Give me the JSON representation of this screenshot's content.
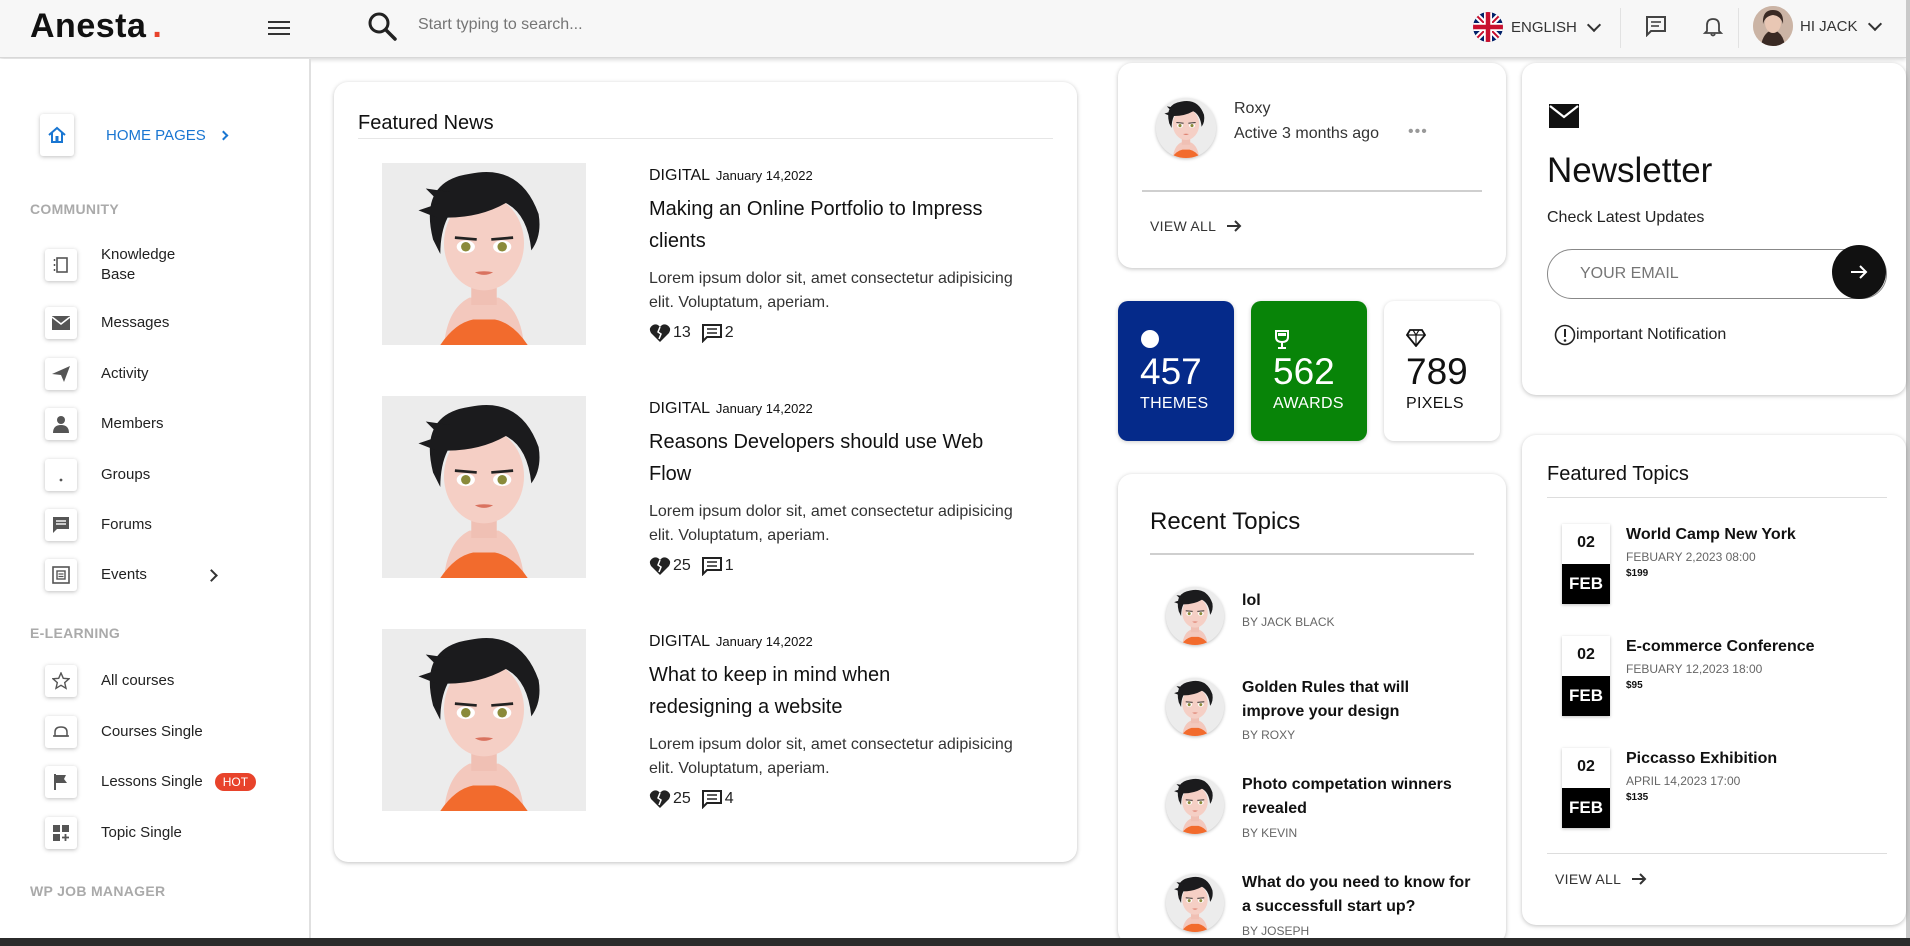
{
  "brand": {
    "name": "Anesta",
    "dot": "."
  },
  "search": {
    "placeholder": "Start typing to search..."
  },
  "header": {
    "language": "ENGLISH",
    "user_greeting": "HI JACK"
  },
  "sidebar": {
    "home_label": "HOME PAGES",
    "sections": {
      "community": "COMMUNITY",
      "elearning": "E-LEARNING",
      "wpjob": "WP JOB MANAGER"
    },
    "community_items": [
      "Knowledge Base",
      "Messages",
      "Activity",
      "Members",
      "Groups",
      "Forums",
      "Events"
    ],
    "elearning_items": [
      "All courses",
      "Courses Single",
      "Lessons Single",
      "Topic Single"
    ],
    "hot_badge": "HOT"
  },
  "featured_news": {
    "title": "Featured News",
    "items": [
      {
        "category": "DIGITAL",
        "date": "January 14,2022",
        "title": "Making an Online Portfolio to Impress clients",
        "excerpt": "Lorem ipsum dolor sit, amet consectetur adipisicing elit. Voluptatum, aperiam.",
        "likes": "13",
        "comments": "2"
      },
      {
        "category": "DIGITAL",
        "date": "January 14,2022",
        "title": "Reasons Developers should use Web Flow",
        "excerpt": "Lorem ipsum dolor sit, amet consectetur adipisicing elit. Voluptatum, aperiam.",
        "likes": "25",
        "comments": "1"
      },
      {
        "category": "DIGITAL",
        "date": "January 14,2022",
        "title": "What to keep in mind when redesigning a website",
        "excerpt": "Lorem ipsum dolor sit, amet consectetur adipisicing elit. Voluptatum, aperiam.",
        "likes": "25",
        "comments": "4"
      }
    ]
  },
  "member": {
    "name": "Roxy",
    "status": "Active 3 months ago",
    "more": "•••",
    "view_all": "VIEW ALL"
  },
  "stats": [
    {
      "value": "457",
      "label": "THEMES",
      "bg": "#052a8a",
      "icon": "circle-icon"
    },
    {
      "value": "562",
      "label": "AWARDS",
      "bg": "#088408",
      "icon": "trophy-icon"
    },
    {
      "value": "789",
      "label": "PIXELS",
      "bg": "#ffffff",
      "icon": "diamond-icon"
    }
  ],
  "recent_topics": {
    "title": "Recent Topics",
    "items": [
      {
        "title": "lol",
        "by": "BY JACK BLACK"
      },
      {
        "title": "Golden Rules that will improve your design",
        "by": "BY ROXY"
      },
      {
        "title": "Photo competation winners revealed",
        "by": "BY KEVIN"
      },
      {
        "title": "What do you need to know for a successfull start up?",
        "by": "BY JOSEPH"
      }
    ]
  },
  "newsletter": {
    "title": "Newsletter",
    "subtitle": "Check Latest Updates",
    "email_placeholder": "YOUR EMAIL",
    "notice": "important Notification"
  },
  "featured_topics": {
    "title": "Featured Topics",
    "view_all": "VIEW ALL",
    "items": [
      {
        "day": "02",
        "month": "FEB",
        "title": "World Camp New York",
        "datetime": "FEBUARY 2,2023 08:00",
        "price": "$199"
      },
      {
        "day": "02",
        "month": "FEB",
        "title": "E-commerce Conference",
        "datetime": "FEBUARY 12,2023 18:00",
        "price": "$95"
      },
      {
        "day": "02",
        "month": "FEB",
        "title": "Piccasso Exhibition",
        "datetime": "APRIL 14,2023 17:00",
        "price": "$135"
      }
    ]
  },
  "colors": {
    "accent_blue": "#1976d2",
    "brand_red": "#e8432b",
    "hot_badge": "#e8432b"
  }
}
